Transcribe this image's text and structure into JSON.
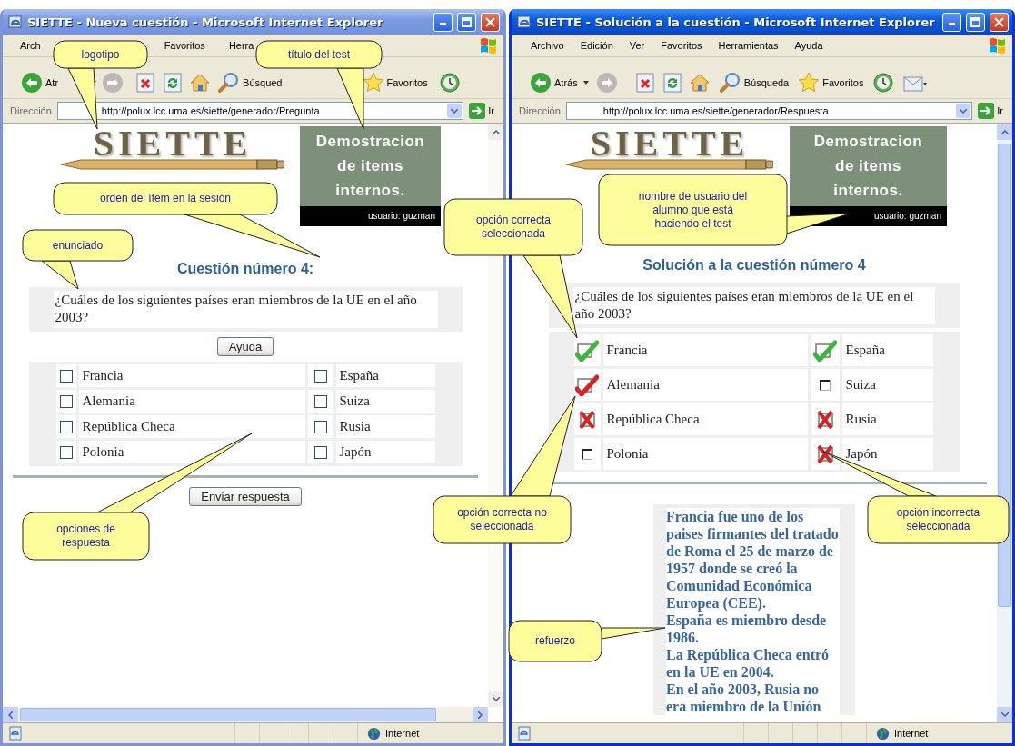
{
  "windows": [
    {
      "title": "SIETTE - Nueva cuestión - Microsoft Internet Explorer",
      "active": false,
      "menu": [
        "Arch",
        "Favoritos",
        "Herra"
      ],
      "toolbar": {
        "back": "Atr",
        "search": "Búsqued",
        "favorites": "Favoritos"
      },
      "address_label": "Dirección",
      "address": "http://polux.lcc.uma.es/siette/generador/Pregunta",
      "go": "Ir",
      "page": {
        "kind": "question",
        "logo": "SIETTE",
        "test_title": "Demostracion de items internos.",
        "user": "usuario: guzman",
        "heading": "Cuestión número 4:",
        "question": "¿Cuáles de los siguientes países eran miembros de la UE en el año 2003?",
        "help_button": "Ayuda",
        "options": [
          {
            "label": "Francia",
            "checked": false
          },
          {
            "label": "España",
            "checked": false
          },
          {
            "label": "Alemania",
            "checked": false
          },
          {
            "label": "Suiza",
            "checked": false
          },
          {
            "label": "República Checa",
            "checked": false
          },
          {
            "label": "Rusia",
            "checked": false
          },
          {
            "label": "Polonia",
            "checked": false
          },
          {
            "label": "Japón",
            "checked": false
          }
        ],
        "submit_button": "Enviar respuesta"
      },
      "status": "Internet"
    },
    {
      "title": "SIETTE - Solución a la cuestión - Microsoft Internet Explorer",
      "active": true,
      "menu": [
        "Archivo",
        "Edición",
        "Ver",
        "Favoritos",
        "Herramientas",
        "Ayuda"
      ],
      "toolbar": {
        "back": "Atrás",
        "search": "Búsqueda",
        "favorites": "Favoritos"
      },
      "address_label": "Dirección",
      "address": "http://polux.lcc.uma.es/siette/generador/Respuesta",
      "go": "Ir",
      "page": {
        "kind": "solution",
        "logo": "SIETTE",
        "test_title": "Demostracion de items internos.",
        "user": "usuario: guzman",
        "heading": "Solución a la cuestión número 4",
        "question": "¿Cuáles de los siguientes países eran miembros de la UE en el año 2003?",
        "options": [
          {
            "label": "Francia",
            "selected": true,
            "correct": true
          },
          {
            "label": "España",
            "selected": true,
            "correct": true
          },
          {
            "label": "Alemania",
            "selected": false,
            "correct": true
          },
          {
            "label": "Suiza",
            "selected": false,
            "correct": false
          },
          {
            "label": "República Checa",
            "selected": true,
            "correct": false
          },
          {
            "label": "Rusia",
            "selected": true,
            "correct": false
          },
          {
            "label": "Polonia",
            "selected": false,
            "correct": false
          },
          {
            "label": "Japón",
            "selected": true,
            "correct": false
          }
        ],
        "feedback": [
          "Francia fue uno de los paises firmantes del tratado de Roma el 25 de marzo de 1957 donde se creó la Comunidad Económica Europea (CEE).",
          "España es miembro desde 1986.",
          "La República Checa entró en la UE en 2004.",
          "En el año 2003, Rusia no era miembro de la Unión"
        ]
      },
      "status": "Internet"
    }
  ],
  "callouts": [
    {
      "text": "logotipo"
    },
    {
      "text": "título del test"
    },
    {
      "text": "orden del ítem en la sesión"
    },
    {
      "text": "enunciado"
    },
    {
      "text": "opciones de respuesta"
    },
    {
      "text": "opción correcta seleccionada"
    },
    {
      "text": "nombre de usuario del alumno que está haciendo el test"
    },
    {
      "text": "opción correcta no seleccionada"
    },
    {
      "text": "opción incorrecta seleccionada"
    },
    {
      "text": "refuerzo"
    }
  ]
}
